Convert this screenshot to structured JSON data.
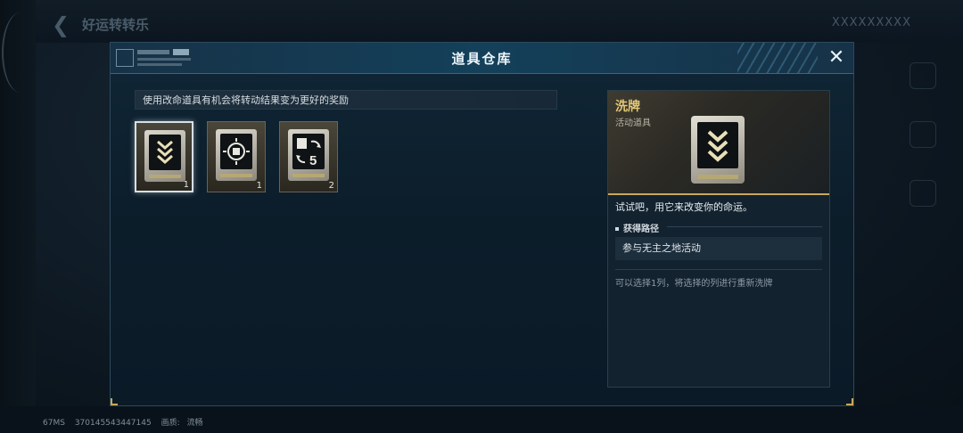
{
  "background": {
    "title": "好运转转乐",
    "top_right": "XXXXXXXXX"
  },
  "status_bar": {
    "ping": "67MS",
    "id": "370145543447145",
    "quality_label": "画质:",
    "quality_value": "流畅"
  },
  "dialog": {
    "title": "道具仓库",
    "close_glyph": "✕",
    "hint": "使用改命道具有机会将转动结果变为更好的奖励",
    "items": [
      {
        "icon": "chevron-stack-icon",
        "count": "1",
        "selected": true
      },
      {
        "icon": "target-square-icon",
        "count": "1",
        "selected": false
      },
      {
        "icon": "swap-five-icon",
        "count": "2",
        "selected": false
      }
    ]
  },
  "detail": {
    "name": "洗牌",
    "type": "活动道具",
    "description": "试试吧，用它来改变你的命运。",
    "source_title": "获得路径",
    "source_value": "参与无主之地活动",
    "note": "可以选择1列，将选择的列进行重新洗牌"
  },
  "colors": {
    "accent_gold": "#c9a85a",
    "header_blue": "#14405a",
    "name_gold": "#e3c878"
  }
}
